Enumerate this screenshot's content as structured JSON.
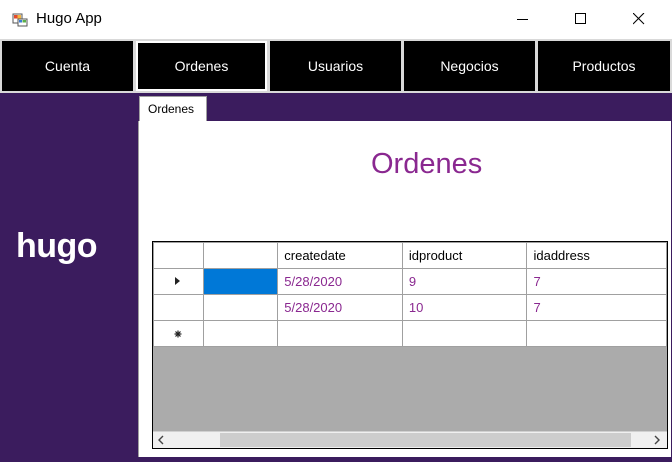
{
  "window": {
    "title": "Hugo App",
    "icon": "app-icon",
    "controls": [
      "minimize-icon",
      "maximize-icon",
      "close-icon"
    ]
  },
  "nav": {
    "items": [
      {
        "label": "Cuenta"
      },
      {
        "label": "Ordenes",
        "active": true
      },
      {
        "label": "Usuarios"
      },
      {
        "label": "Negocios"
      },
      {
        "label": "Productos"
      }
    ]
  },
  "sidebar": {
    "logo_text": "hugo"
  },
  "tab": {
    "label": "Ordenes"
  },
  "panel": {
    "title": "Ordenes"
  },
  "grid": {
    "columns": [
      "",
      "createdate",
      "idproduct",
      "idaddress"
    ],
    "rows": [
      {
        "marker": "current-row-icon",
        "cells": [
          "",
          "5/28/2020",
          "9",
          "7"
        ]
      },
      {
        "marker": "",
        "cells": [
          "",
          "5/28/2020",
          "10",
          "7"
        ]
      }
    ],
    "new_row_marker": "new-row-icon"
  },
  "colors": {
    "accent_purple": "#8a2890",
    "sidebar_bg": "#3b1c5e",
    "nav_bg": "#000000",
    "selection": "#0078d7",
    "grid_empty": "#ababab"
  }
}
